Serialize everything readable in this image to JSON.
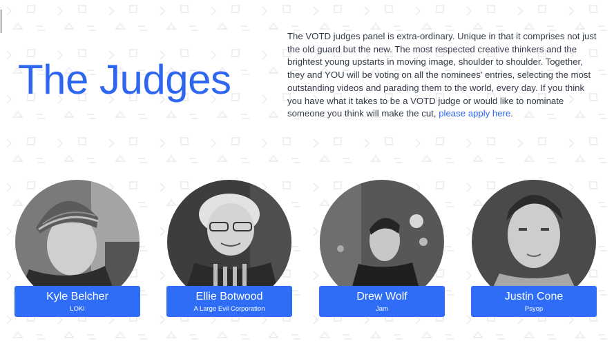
{
  "page": {
    "title": "The Judges",
    "intro_text": "The VOTD judges panel is extra-ordinary. Unique in that it comprises not just the old guard but the new. The most respected creative thinkers and the brightest young upstarts in moving image, shoulder to shoulder. Together, they and YOU will be voting on all the nominees' entries, selecting the most outstanding videos and parading them to the world, every day. If you think you have what it takes to be a VOTD judge or would like to nominate someone you think will make the cut,",
    "apply_link": "please apply here",
    "after_link": "."
  },
  "judges": [
    {
      "name": "Kyle Belcher",
      "org": "LOKI"
    },
    {
      "name": "Ellie Botwood",
      "org": "A Large Evil Corporation"
    },
    {
      "name": "Drew Wolf",
      "org": "Jam"
    },
    {
      "name": "Justin Cone",
      "org": "Psyop"
    }
  ],
  "colors": {
    "accent": "#2f66f0",
    "card": "#2f6df6",
    "body_text": "#333a47"
  }
}
